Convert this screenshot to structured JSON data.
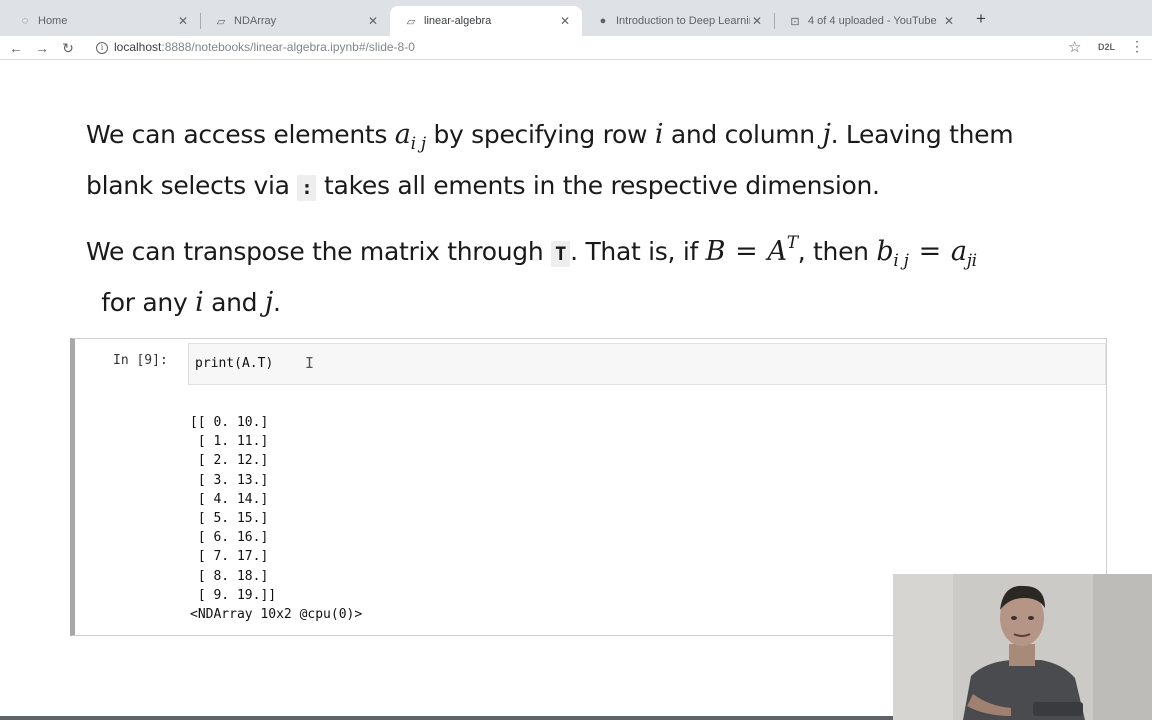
{
  "tabs": [
    {
      "title": "Home",
      "icon": "loading-icon",
      "active": false
    },
    {
      "title": "NDArray",
      "icon": "notebook-icon",
      "active": false
    },
    {
      "title": "linear-algebra",
      "icon": "notebook-icon",
      "active": true
    },
    {
      "title": "Introduction to Deep Learning",
      "icon": "globe-icon",
      "active": false
    },
    {
      "title": "4 of 4 uploaded - YouTube",
      "icon": "upload-icon",
      "active": false
    }
  ],
  "toolbar": {
    "url_host": "localhost",
    "url_path": ":8888/notebooks/linear-algebra.ipynb#/slide-8-0",
    "extension_label": "D2L"
  },
  "slide": {
    "p1_a": "We can access elements ",
    "p1_aij_base": "a",
    "p1_aij_sub": "i j",
    "p1_b": " by specifying row ",
    "p1_i": "i",
    "p1_c": " and column ",
    "p1_j": "j",
    "p1_d": ". Leaving them blank selects via ",
    "p1_colon": ":",
    "p1_e": " takes all ements in the respective dimension.",
    "p2_a": "We can transpose the matrix through ",
    "p2_T": "T",
    "p2_b": ". That is, if ",
    "p2_B": "B",
    "p2_eq1": "=",
    "p2_A": "A",
    "p2_sup": "T",
    "p2_c": ", then ",
    "p2_bij_base": "b",
    "p2_bij_sub": "i j",
    "p2_eq2": "=",
    "p2_aji_base": "a",
    "p2_aji_sub": "ji",
    "p2_d": "  for any ",
    "p2_i": "i",
    "p2_e": " and ",
    "p2_j": "j",
    "p2_f": "."
  },
  "cell": {
    "prompt": "In [9]:",
    "code": "print(A.T)",
    "output_lines": [
      "[[ 0. 10.]",
      " [ 1. 11.]",
      " [ 2. 12.]",
      " [ 3. 13.]",
      " [ 4. 14.]",
      " [ 5. 15.]",
      " [ 6. 16.]",
      " [ 7. 17.]",
      " [ 8. 18.]",
      " [ 9. 19.]]",
      "<NDArray 10x2 @cpu(0)>"
    ]
  },
  "colors": {
    "tabstrip": "#dee1e6",
    "cell_border_left": "#a8a8a8",
    "input_bg": "#f7f7f7"
  }
}
